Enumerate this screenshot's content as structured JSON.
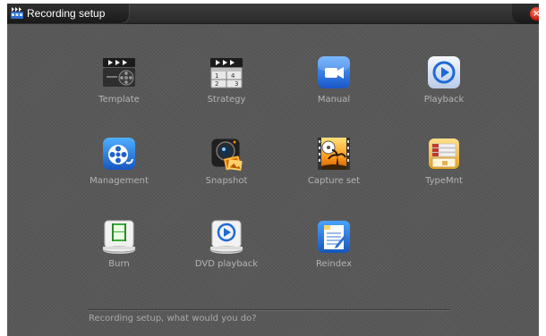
{
  "window": {
    "title": "Recording setup",
    "title_icon": "film-arrows-icon",
    "close_icon": "close-icon"
  },
  "tiles": [
    {
      "label": "Template",
      "icon": "clapperboard-reel-icon"
    },
    {
      "label": "Strategy",
      "icon": "clapperboard-calendar-icon"
    },
    {
      "label": "Manual",
      "icon": "video-camera-icon"
    },
    {
      "label": "Playback",
      "icon": "play-circle-icon"
    },
    {
      "label": "Management",
      "icon": "film-reel-icon"
    },
    {
      "label": "Snapshot",
      "icon": "camera-photos-icon"
    },
    {
      "label": "Capture set",
      "icon": "film-sunset-icon"
    },
    {
      "label": "TypeMnt",
      "icon": "folder-tabs-icon"
    },
    {
      "label": "Burn",
      "icon": "film-burn-icon"
    },
    {
      "label": "DVD playback",
      "icon": "dvd-play-icon"
    },
    {
      "label": "Reindex",
      "icon": "document-index-icon"
    }
  ],
  "status": {
    "prompt": "Recording setup, what would you do?"
  },
  "colors": {
    "background": "#585858",
    "label": "#b5b5b5",
    "titlebar": "#2a2a2a",
    "close": "#d0200e"
  }
}
